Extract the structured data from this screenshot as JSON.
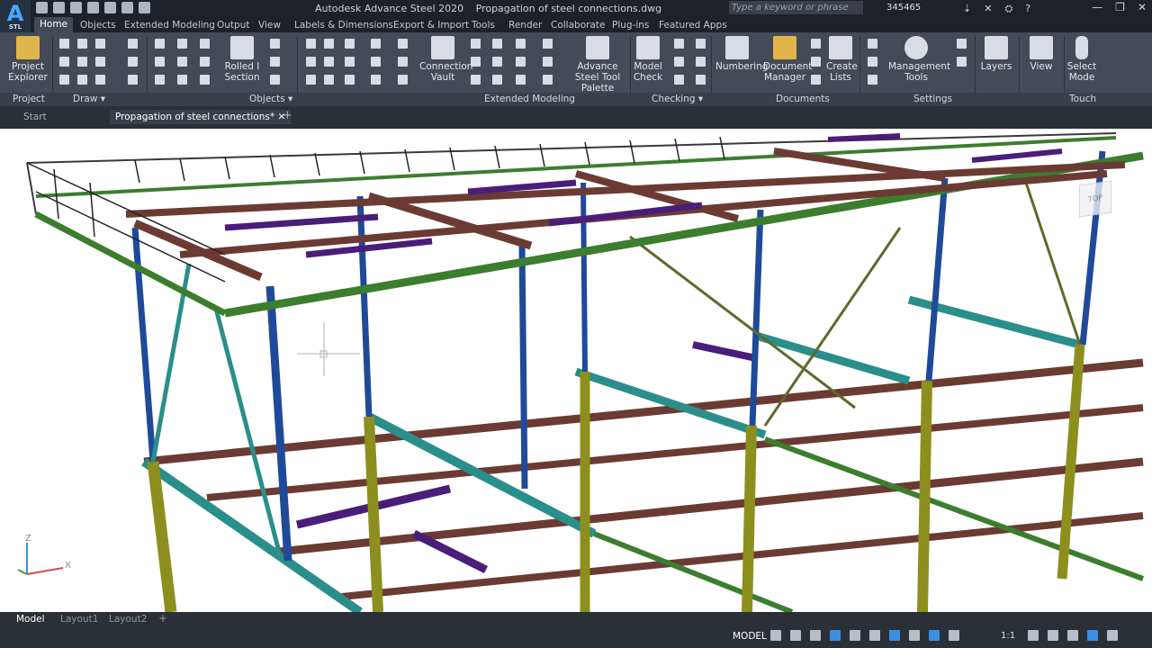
{
  "app": {
    "logo_letter": "A",
    "logo_sub": "STL",
    "title": "Autodesk Advance Steel 2020",
    "file": "Propagation of steel connections.dwg",
    "search_placeholder": "Type a keyword or phrase",
    "user_id": "345465"
  },
  "tabs": [
    "Home",
    "Objects",
    "Extended Modeling",
    "Output",
    "View",
    "Labels & Dimensions",
    "Export & Import",
    "Tools",
    "Render",
    "Collaborate",
    "Plug-ins",
    "Featured Apps"
  ],
  "ribbon": {
    "panels": [
      "Project",
      "Draw",
      "Objects",
      "Extended Modeling",
      "Checking",
      "Documents",
      "Settings",
      "Touch"
    ],
    "buttons": {
      "project_explorer": "Project Explorer",
      "rolled_section": "Rolled I Section",
      "connection_vault": "Connection Vault",
      "tool_palette": "Advance Steel Tool Palette",
      "model_check": "Model Check",
      "numbering": "Numbering",
      "document_manager": "Document Manager",
      "create_lists": "Create Lists",
      "management_tools": "Management Tools",
      "layers": "Layers",
      "view": "View",
      "select_mode": "Select Mode"
    }
  },
  "doc_tabs": {
    "start": "Start",
    "active": "Propagation of steel connections*"
  },
  "layout_tabs": [
    "Model",
    "Layout1",
    "Layout2"
  ],
  "status": {
    "model": "MODEL",
    "scale": "1:1"
  },
  "axis": {
    "x": "X",
    "y": "Y",
    "z": "Z"
  },
  "colors": {
    "beam_brown": "#6b3b33",
    "beam_blue": "#1f4a9a",
    "beam_yellow": "#8c8f1d",
    "beam_teal": "#2a8e8a",
    "beam_purple": "#4a1d7a",
    "beam_green": "#3c7d2e",
    "beam_olive": "#5d6a2a"
  }
}
